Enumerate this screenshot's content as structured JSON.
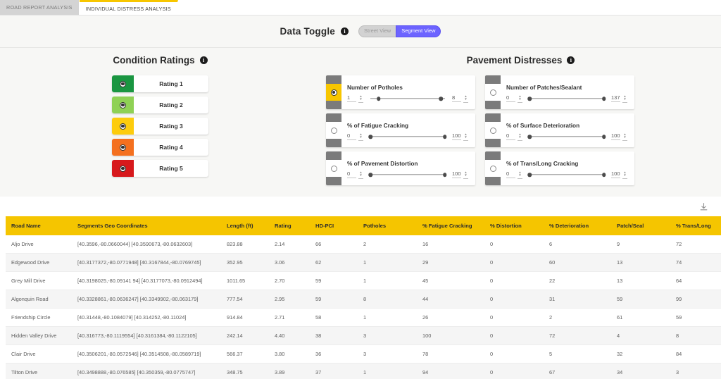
{
  "tabs": [
    {
      "label": "ROAD REPORT ANALYSIS",
      "active": false
    },
    {
      "label": "INDIVIDUAL DISTRESS ANALYSIS",
      "active": true
    }
  ],
  "data_toggle": {
    "title": "Data Toggle",
    "info_glyph": "i",
    "options": [
      {
        "label": "Street View",
        "selected": false
      },
      {
        "label": "Segment View",
        "selected": true
      }
    ],
    "accent_color": "#6c63ff"
  },
  "condition_ratings": {
    "title": "Condition Ratings",
    "info_glyph": "i",
    "items": [
      {
        "label": "Rating 1",
        "color": "#1a9641",
        "selected": true
      },
      {
        "label": "Rating 2",
        "color": "#8fd155",
        "selected": true
      },
      {
        "label": "Rating 3",
        "color": "#fdcc0d",
        "selected": true
      },
      {
        "label": "Rating 4",
        "color": "#f4701f",
        "selected": true
      },
      {
        "label": "Rating 5",
        "color": "#d7191c",
        "selected": true
      }
    ]
  },
  "pavement_distresses": {
    "title": "Pavement Distresses",
    "info_glyph": "i",
    "columns": [
      [
        {
          "label": "Number of Potholes",
          "min": "1",
          "max": "8",
          "active": true,
          "knob_left_pct": 13,
          "knob_right_pct": 92
        },
        {
          "label": "% of Fatigue Cracking",
          "min": "0",
          "max": "100",
          "active": false,
          "knob_left_pct": 3,
          "knob_right_pct": 97
        },
        {
          "label": "% of Pavement Distortion",
          "min": "0",
          "max": "100",
          "active": false,
          "knob_left_pct": 3,
          "knob_right_pct": 97
        }
      ],
      [
        {
          "label": "Number of Patches/Sealant",
          "min": "0",
          "max": "137",
          "active": false,
          "knob_left_pct": 3,
          "knob_right_pct": 97
        },
        {
          "label": "% of Surface Deterioration",
          "min": "0",
          "max": "100",
          "active": false,
          "knob_left_pct": 3,
          "knob_right_pct": 97
        },
        {
          "label": "% of Trans/Long Cracking",
          "min": "0",
          "max": "100",
          "active": false,
          "knob_left_pct": 3,
          "knob_right_pct": 97
        }
      ]
    ]
  },
  "table": {
    "download_icon": "download-icon",
    "headers": [
      "Road Name",
      "Segments Geo Coordinates",
      "Length (ft)",
      "Rating",
      "HD-PCI",
      "Potholes",
      "% Fatigue Cracking",
      "% Distortion",
      "% Deterioration",
      "Patch/Seal",
      "% Trans/Long"
    ],
    "rows": [
      [
        "Aljo Drive",
        "[40.3596,-80.0660044] [40.3590673,-80.0632603]",
        "823.88",
        "2.14",
        "66",
        "2",
        "16",
        "0",
        "6",
        "9",
        "72"
      ],
      [
        "Edgewood Drive",
        "[40.3177372,-80.0771948] [40.3167844,-80.0769745]",
        "352.95",
        "3.06",
        "62",
        "1",
        "29",
        "0",
        "60",
        "13",
        "74"
      ],
      [
        "Grey Mill Drive",
        "[40.3198025,-80.09141 94] [40.3177073,-80.0912494]",
        "1011.65",
        "2.70",
        "59",
        "1",
        "45",
        "0",
        "22",
        "13",
        "64"
      ],
      [
        "Algonquin Road",
        "[40.3328861,-80.0636247] [40.3349902,-80.063179]",
        "777.54",
        "2.95",
        "59",
        "8",
        "44",
        "0",
        "31",
        "59",
        "99"
      ],
      [
        "Friendship Circle",
        "[40.31448,-80.1084079] [40.314252,-80.11024]",
        "914.84",
        "2.71",
        "58",
        "1",
        "26",
        "0",
        "2",
        "61",
        "59"
      ],
      [
        "Hidden Valley Drive",
        "[40.316773,-80.1119554] [40.3161384,-80.1122105]",
        "242.14",
        "4.40",
        "38",
        "3",
        "100",
        "0",
        "72",
        "4",
        "8"
      ],
      [
        "Clair Drive",
        "[40.3506201,-80.0572546] [40.3514508,-80.0589719]",
        "566.37",
        "3.80",
        "36",
        "3",
        "78",
        "0",
        "5",
        "32",
        "84"
      ],
      [
        "Tilton Drive",
        "[40.3498888,-80.076585] [40.350359,-80.0775747]",
        "348.75",
        "3.89",
        "37",
        "1",
        "94",
        "0",
        "67",
        "34",
        "3"
      ]
    ]
  }
}
